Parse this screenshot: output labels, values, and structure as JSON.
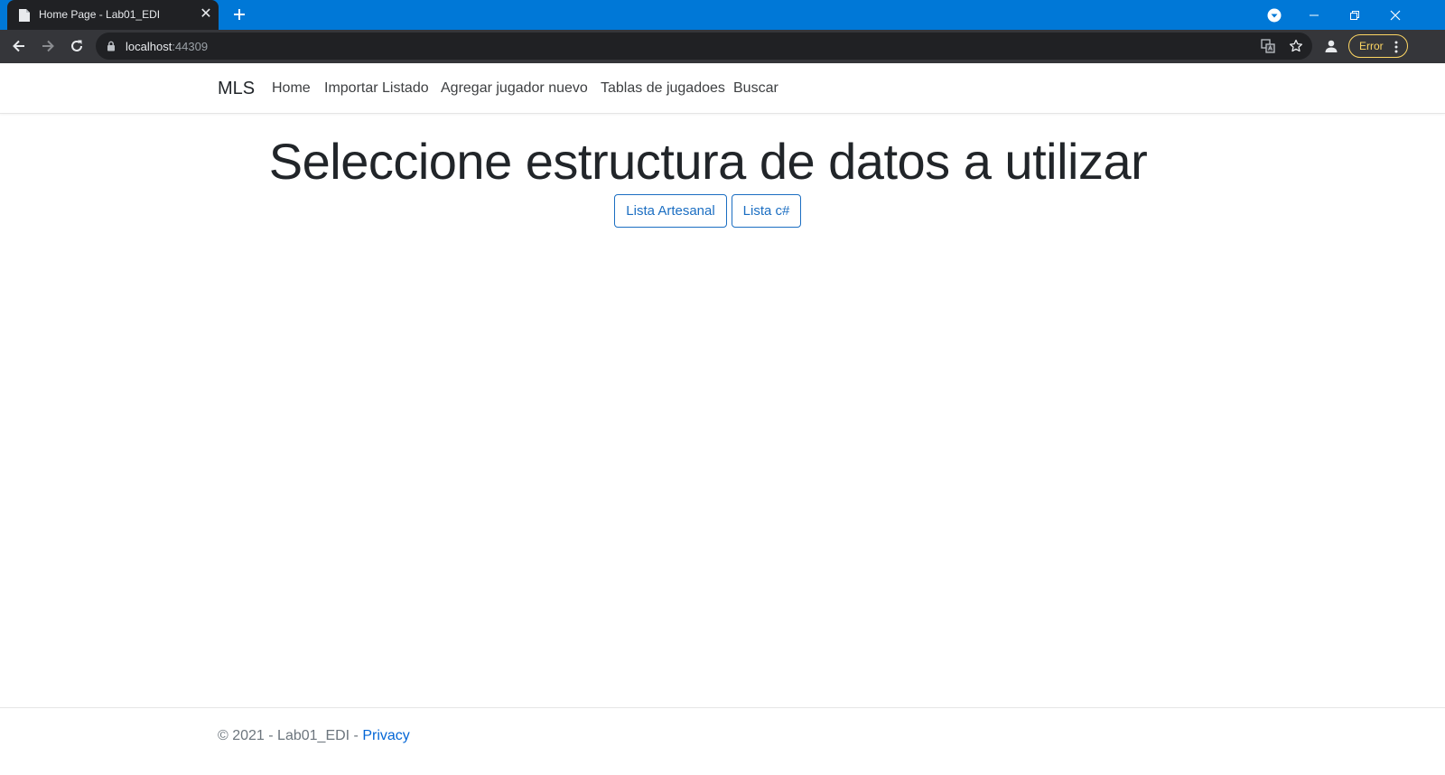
{
  "browser": {
    "tab_title": "Home Page - Lab01_EDI",
    "url_host": "localhost",
    "url_port": ":44309",
    "profile_status": "Error"
  },
  "site": {
    "brand": "MLS",
    "nav": [
      "Home",
      "Importar Listado",
      "Agregar jugador nuevo",
      "Tablas de jugadoes",
      "Buscar"
    ]
  },
  "main": {
    "title": "Seleccione estructura de datos a utilizar",
    "buttons": [
      "Lista Artesanal",
      "Lista c#"
    ]
  },
  "footer": {
    "text": "© 2021 - Lab01_EDI - ",
    "link": "Privacy"
  },
  "colors": {
    "titlebar": "#0078d7",
    "toolbar": "#35363a",
    "accent": "#1b6ec2",
    "link": "#0366d6",
    "error": "#fdd663"
  }
}
